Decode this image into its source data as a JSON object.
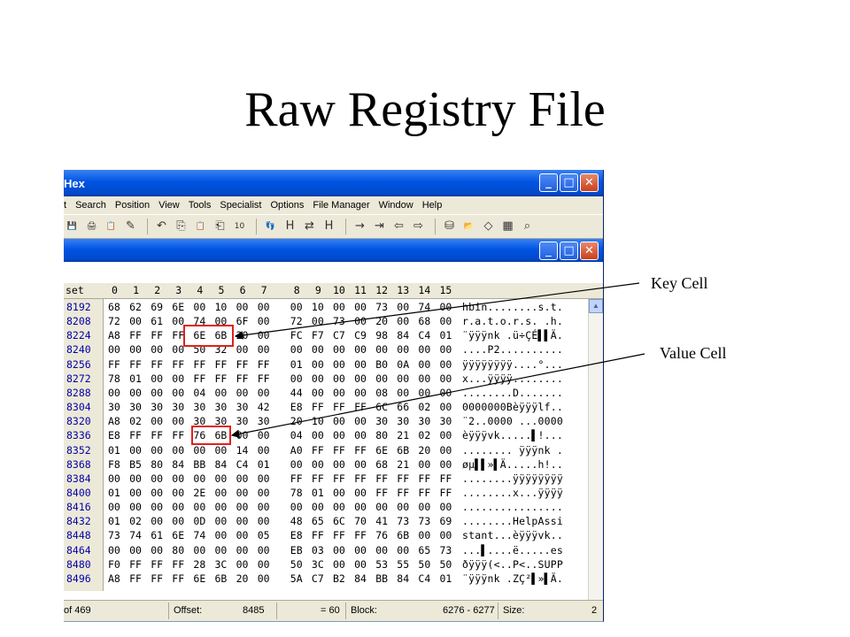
{
  "slide": {
    "title": "Raw Registry File"
  },
  "window": {
    "title": "Hex",
    "menus": [
      "t",
      "Search",
      "Position",
      "View",
      "Tools",
      "Specialist",
      "Options",
      "File Manager",
      "Window",
      "Help"
    ],
    "toolbar_icons": [
      "save-icon",
      "print-icon",
      "properties-icon",
      "edit-icon",
      "undo-icon",
      "copy-icon",
      "paste-icon",
      "paste-special-icon",
      "binary-icon",
      "find-icon",
      "find-hex-icon",
      "replace-icon",
      "replace-hex-icon",
      "goto-icon",
      "goto-offset-icon",
      "back-icon",
      "forward-icon",
      "disk-icon",
      "open-disk-icon",
      "ram-icon",
      "calculator-icon",
      "search-icon"
    ],
    "toolbar_glyphs": [
      "💾",
      "🖨",
      "📋",
      "✎",
      "↶",
      "⎘",
      "📋",
      "⎗",
      "10",
      "👣",
      "H",
      "⇄",
      "H",
      "→",
      "⇥",
      "⇦",
      "⇨",
      "⛁",
      "📂",
      "◇",
      "▦",
      "⌕"
    ]
  },
  "hex_view": {
    "offset_label": "set",
    "column_headers": [
      "0",
      "1",
      "2",
      "3",
      "4",
      "5",
      "6",
      "7",
      "8",
      "9",
      "10",
      "11",
      "12",
      "13",
      "14",
      "15"
    ],
    "rows": [
      {
        "offset": "8192",
        "bytes": [
          "68",
          "62",
          "69",
          "6E",
          "00",
          "10",
          "00",
          "00",
          "00",
          "10",
          "00",
          "00",
          "73",
          "00",
          "74",
          "00"
        ],
        "ascii": "hbin........s.t."
      },
      {
        "offset": "8208",
        "bytes": [
          "72",
          "00",
          "61",
          "00",
          "74",
          "00",
          "6F",
          "00",
          "72",
          "00",
          "73",
          "00",
          "20",
          "00",
          "68",
          "00"
        ],
        "ascii": "r.a.t.o.r.s. .h."
      },
      {
        "offset": "8224",
        "bytes": [
          "A8",
          "FF",
          "FF",
          "FF",
          "6E",
          "6B",
          "20",
          "00",
          "FC",
          "F7",
          "C7",
          "C9",
          "98",
          "84",
          "C4",
          "01"
        ],
        "ascii": "¨ÿÿÿnk .ü÷ÇÉ▌▌Ä."
      },
      {
        "offset": "8240",
        "bytes": [
          "00",
          "00",
          "00",
          "00",
          "50",
          "32",
          "00",
          "00",
          "00",
          "00",
          "00",
          "00",
          "00",
          "00",
          "00",
          "00"
        ],
        "ascii": "....P2.........."
      },
      {
        "offset": "8256",
        "bytes": [
          "FF",
          "FF",
          "FF",
          "FF",
          "FF",
          "FF",
          "FF",
          "FF",
          "01",
          "00",
          "00",
          "00",
          "B0",
          "0A",
          "00",
          "00"
        ],
        "ascii": "ÿÿÿÿÿÿÿÿ....°..."
      },
      {
        "offset": "8272",
        "bytes": [
          "78",
          "01",
          "00",
          "00",
          "FF",
          "FF",
          "FF",
          "FF",
          "00",
          "00",
          "00",
          "00",
          "00",
          "00",
          "00",
          "00"
        ],
        "ascii": "x...ÿÿÿÿ........"
      },
      {
        "offset": "8288",
        "bytes": [
          "00",
          "00",
          "00",
          "00",
          "04",
          "00",
          "00",
          "00",
          "44",
          "00",
          "00",
          "00",
          "08",
          "00",
          "00",
          "00"
        ],
        "ascii": "........D......."
      },
      {
        "offset": "8304",
        "bytes": [
          "30",
          "30",
          "30",
          "30",
          "30",
          "30",
          "30",
          "42",
          "E8",
          "FF",
          "FF",
          "FF",
          "6C",
          "66",
          "02",
          "00"
        ],
        "ascii": "0000000Bèÿÿÿlf.."
      },
      {
        "offset": "8320",
        "bytes": [
          "A8",
          "02",
          "00",
          "00",
          "30",
          "30",
          "30",
          "30",
          "20",
          "10",
          "00",
          "00",
          "30",
          "30",
          "30",
          "30"
        ],
        "ascii": "¨2..0000 ...0000"
      },
      {
        "offset": "8336",
        "bytes": [
          "E8",
          "FF",
          "FF",
          "FF",
          "76",
          "6B",
          "00",
          "00",
          "04",
          "00",
          "00",
          "00",
          "80",
          "21",
          "02",
          "00"
        ],
        "ascii": "èÿÿÿvk.....▌!..."
      },
      {
        "offset": "8352",
        "bytes": [
          "01",
          "00",
          "00",
          "00",
          "00",
          "00",
          "14",
          "00",
          "A0",
          "FF",
          "FF",
          "FF",
          "6E",
          "6B",
          "20",
          "00"
        ],
        "ascii": "........ ÿÿÿnk ."
      },
      {
        "offset": "8368",
        "bytes": [
          "F8",
          "B5",
          "80",
          "84",
          "BB",
          "84",
          "C4",
          "01",
          "00",
          "00",
          "00",
          "00",
          "68",
          "21",
          "00",
          "00"
        ],
        "ascii": "øµ▌▌»▌Ä.....h!.."
      },
      {
        "offset": "8384",
        "bytes": [
          "00",
          "00",
          "00",
          "00",
          "00",
          "00",
          "00",
          "00",
          "FF",
          "FF",
          "FF",
          "FF",
          "FF",
          "FF",
          "FF",
          "FF"
        ],
        "ascii": "........ÿÿÿÿÿÿÿÿ"
      },
      {
        "offset": "8400",
        "bytes": [
          "01",
          "00",
          "00",
          "00",
          "2E",
          "00",
          "00",
          "00",
          "78",
          "01",
          "00",
          "00",
          "FF",
          "FF",
          "FF",
          "FF"
        ],
        "ascii": "........x...ÿÿÿÿ"
      },
      {
        "offset": "8416",
        "bytes": [
          "00",
          "00",
          "00",
          "00",
          "00",
          "00",
          "00",
          "00",
          "00",
          "00",
          "00",
          "00",
          "00",
          "00",
          "00",
          "00"
        ],
        "ascii": "................"
      },
      {
        "offset": "8432",
        "bytes": [
          "01",
          "02",
          "00",
          "00",
          "0D",
          "00",
          "00",
          "00",
          "48",
          "65",
          "6C",
          "70",
          "41",
          "73",
          "73",
          "69"
        ],
        "ascii": "........HelpAssi"
      },
      {
        "offset": "8448",
        "bytes": [
          "73",
          "74",
          "61",
          "6E",
          "74",
          "00",
          "00",
          "05",
          "E8",
          "FF",
          "FF",
          "FF",
          "76",
          "6B",
          "00",
          "00"
        ],
        "ascii": "stant...èÿÿÿvk.."
      },
      {
        "offset": "8464",
        "bytes": [
          "00",
          "00",
          "00",
          "80",
          "00",
          "00",
          "00",
          "00",
          "EB",
          "03",
          "00",
          "00",
          "00",
          "00",
          "65",
          "73"
        ],
        "ascii": "...▌....ë.....es"
      },
      {
        "offset": "8480",
        "bytes": [
          "F0",
          "FF",
          "FF",
          "FF",
          "28",
          "3C",
          "00",
          "00",
          "50",
          "3C",
          "00",
          "00",
          "53",
          "55",
          "50",
          "50"
        ],
        "ascii": "ðÿÿÿ(<..P<..SUPP"
      },
      {
        "offset": "8496",
        "bytes": [
          "A8",
          "FF",
          "FF",
          "FF",
          "6E",
          "6B",
          "20",
          "00",
          "5A",
          "C7",
          "B2",
          "84",
          "BB",
          "84",
          "C4",
          "01"
        ],
        "ascii": "¨ÿÿÿnk .ZÇ²▌»▌Ä."
      }
    ]
  },
  "status_bar": {
    "page": "of 469",
    "offset_label": "Offset:",
    "offset_value": "8485",
    "eq_value": "= 60",
    "block_label": "Block:",
    "block_value": "6276 - 6277",
    "size_label": "Size:",
    "size_value": "2"
  },
  "annotations": {
    "key_cell": "Key Cell",
    "value_cell": "Value Cell",
    "highlight_color": "#e0201c"
  }
}
